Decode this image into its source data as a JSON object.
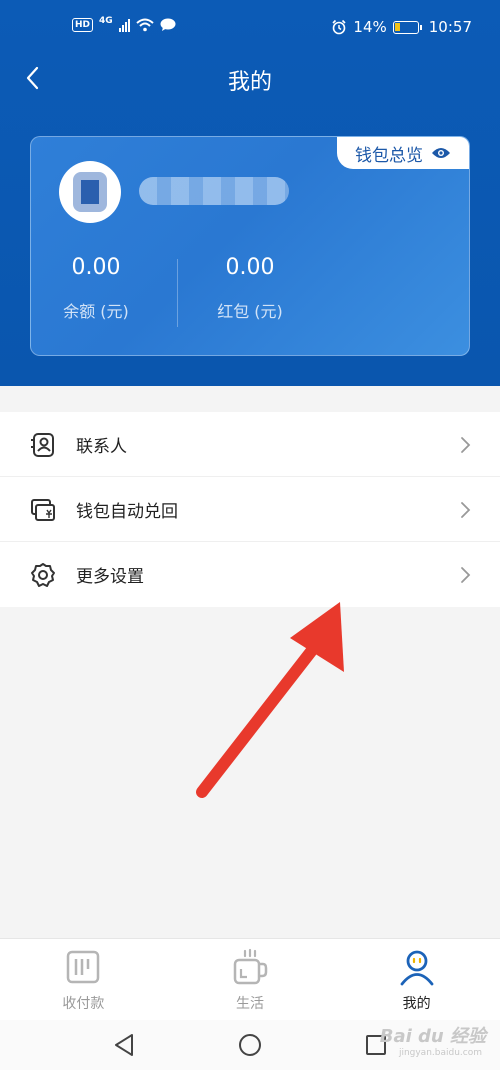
{
  "status_bar": {
    "badge_hd": "HD",
    "network": "4G",
    "battery_percent": "14%",
    "time": "10:57"
  },
  "nav": {
    "title": "我的"
  },
  "wallet_card": {
    "overview_label": "钱包总览",
    "balance": {
      "value": "0.00",
      "label": "余额 (元)"
    },
    "red_packet": {
      "value": "0.00",
      "label": "红包 (元)"
    }
  },
  "menu": {
    "items": [
      {
        "label": "联系人",
        "icon": "contacts-icon"
      },
      {
        "label": "钱包自动兑回",
        "icon": "wallet-redeem-icon"
      },
      {
        "label": "更多设置",
        "icon": "gear-icon"
      }
    ]
  },
  "tabs": [
    {
      "label": "收付款",
      "icon": "payment-icon",
      "active": false
    },
    {
      "label": "生活",
      "icon": "cup-icon",
      "active": false
    },
    {
      "label": "我的",
      "icon": "profile-icon",
      "active": true
    }
  ],
  "watermark": {
    "brand": "Bai du 经验",
    "domain": "jingyan.baidu.com"
  },
  "colors": {
    "header_blue": "#0c5bb6",
    "card_blue": "#2f7fd8",
    "accent_blue": "#1c58a8",
    "annotation_red": "#e8392c"
  }
}
